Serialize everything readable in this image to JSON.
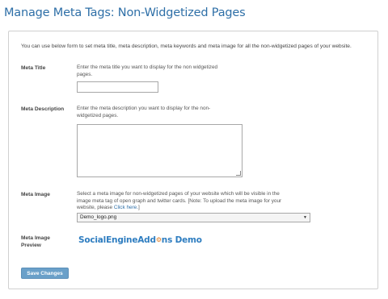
{
  "page": {
    "title": "Manage Meta Tags: Non-Widgetized Pages"
  },
  "form": {
    "intro": "You can use below form to set meta title, meta description, meta keywords and meta image for all the non-widgetized pages of your website.",
    "meta_title": {
      "label": "Meta Title",
      "description_line1": "Enter the meta title you want to display for the non widgetized",
      "description_line2": "pages.",
      "value": ""
    },
    "meta_description": {
      "label": "Meta Description",
      "description_line1": "Enter the meta description you want to display for the non-",
      "description_line2": "widgetized pages.",
      "value": ""
    },
    "meta_image": {
      "label": "Meta Image",
      "description_line1": "Select a meta image for non-widgetized pages of your website which will be visible in the",
      "description_line2": "image meta tag of open graph and twitter cards. [Note: To upload the meta image for your",
      "description_line3_prefix": "website, please ",
      "description_link": "Click here.",
      "description_line3_suffix": "]",
      "selected": "Demo_logo.png"
    },
    "meta_image_preview": {
      "label_line1": "Meta Image",
      "label_line2": "Preview",
      "logo_part1": "SocialEngineAdd",
      "logo_gear": "⚙",
      "logo_part2": "ns Demo"
    },
    "save_label": "Save Changes"
  },
  "colors": {
    "title": "#2e6fa7",
    "button": "#6aa0c9",
    "logo_blue": "#2e7dc0",
    "logo_orange": "#e07b1f"
  }
}
